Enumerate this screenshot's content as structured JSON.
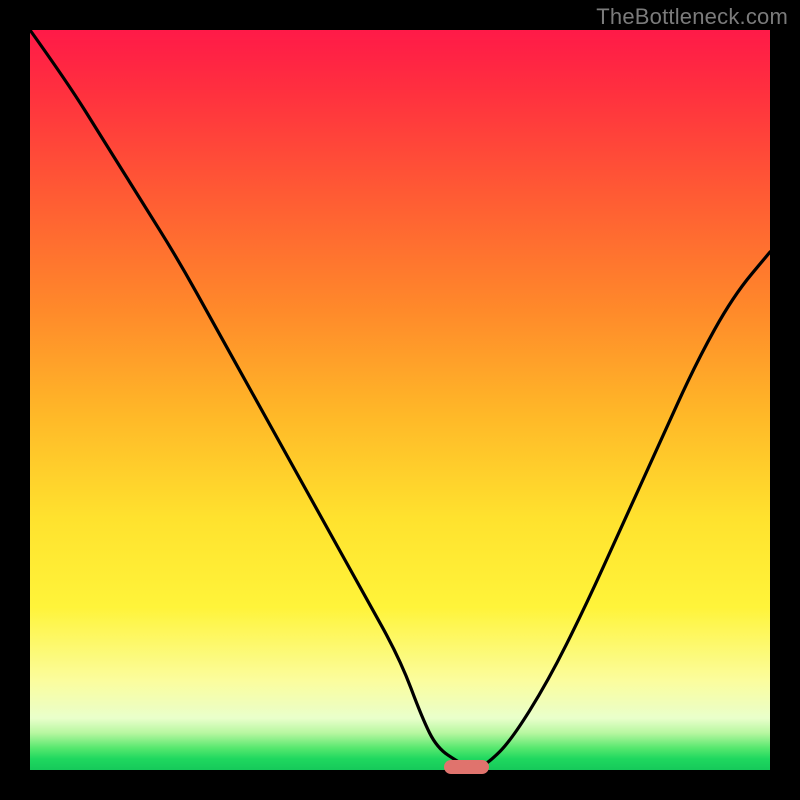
{
  "watermark": "TheBottleneck.com",
  "colors": {
    "background": "#000000",
    "gradient_top": "#ff1a48",
    "gradient_bottom": "#16c95a",
    "curve": "#000000",
    "marker": "#e0736d",
    "watermark": "#7b7b7b"
  },
  "chart_data": {
    "type": "line",
    "title": "",
    "xlabel": "",
    "ylabel": "",
    "xlim": [
      0,
      100
    ],
    "ylim": [
      0,
      100
    ],
    "grid": false,
    "legend": false,
    "series": [
      {
        "name": "bottleneck-curve",
        "x": [
          0,
          5,
          10,
          15,
          20,
          25,
          30,
          35,
          40,
          45,
          50,
          53,
          55,
          58,
          60,
          62,
          65,
          70,
          75,
          80,
          85,
          90,
          95,
          100
        ],
        "y": [
          100,
          93,
          85,
          77,
          69,
          60,
          51,
          42,
          33,
          24,
          15,
          7,
          3,
          1,
          0,
          1,
          4,
          12,
          22,
          33,
          44,
          55,
          64,
          70
        ]
      }
    ],
    "annotations": [
      {
        "name": "optimal-marker",
        "x": 59,
        "y": 0,
        "width_pct": 6
      }
    ],
    "background_gradient": {
      "orientation": "vertical",
      "stops": [
        {
          "pos": 0.0,
          "color": "#ff1a48"
        },
        {
          "pos": 0.38,
          "color": "#ff8a2a"
        },
        {
          "pos": 0.66,
          "color": "#ffe22e"
        },
        {
          "pos": 0.93,
          "color": "#e9ffcb"
        },
        {
          "pos": 1.0,
          "color": "#16c95a"
        }
      ]
    }
  }
}
